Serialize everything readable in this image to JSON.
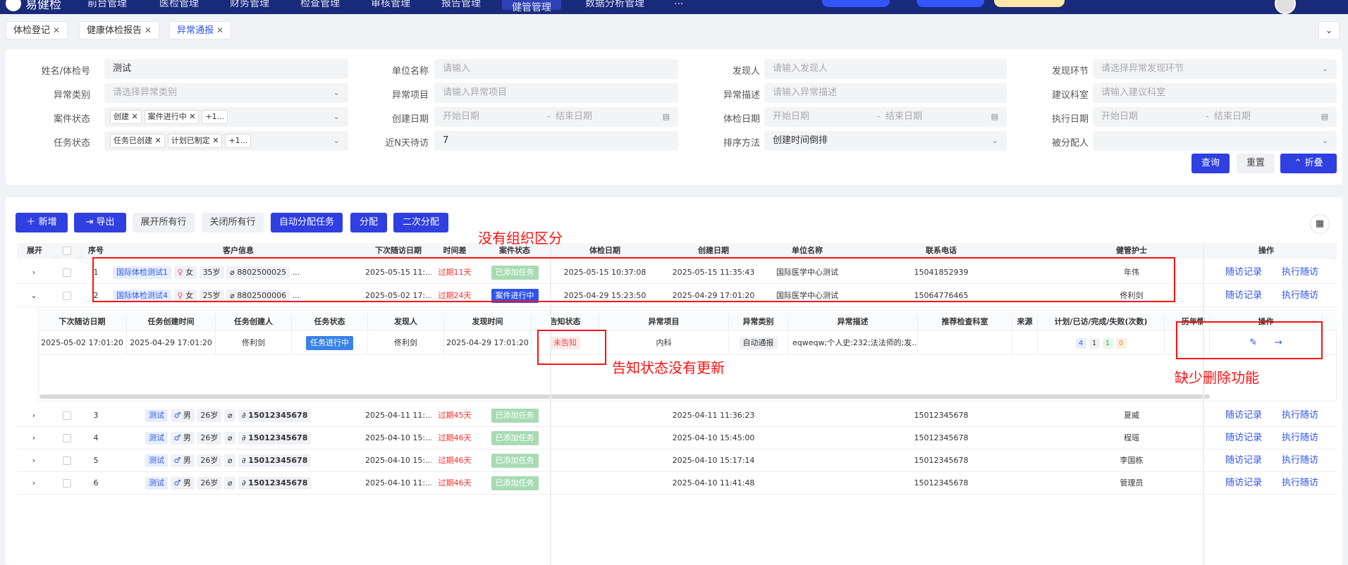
{
  "topbar": {
    "brand": "易健检",
    "nav": [
      "前台管理",
      "医检管理",
      "财务管理",
      "检查管理",
      "审核管理",
      "报告管理",
      "健管管理",
      "数据分析管理",
      "..."
    ]
  },
  "tabs": [
    {
      "label": "体检登记"
    },
    {
      "label": "健康体检报告"
    },
    {
      "label": "异常通报"
    }
  ],
  "tabs_more_icon": "chevron-down-icon",
  "filters": {
    "name_label": "姓名/体检号",
    "name_value": "测试",
    "company_label": "单位名称",
    "company_ph": "请输入",
    "finder_label": "发现人",
    "finder_ph": "请输入发现人",
    "stage_label": "发现环节",
    "stage_ph": "请选择异常发现环节",
    "abn_type_label": "异常类别",
    "abn_type_ph": "请选择异常类别",
    "abn_item_label": "异常项目",
    "abn_item_ph": "请输入异常项目",
    "abn_desc_label": "异常描述",
    "abn_desc_ph": "请输入异常描述",
    "dept_label": "建议科室",
    "dept_ph": "请输入建议科室",
    "case_status_label": "案件状态",
    "case_chips": [
      "创建",
      "案件进行中",
      "+1..."
    ],
    "create_date_label": "创建日期",
    "exam_date_label": "体检日期",
    "exec_date_label": "执行日期",
    "start_ph": "开始日期",
    "end_ph": "结束日期",
    "sep": "-",
    "task_status_label": "任务状态",
    "task_chips": [
      "任务已创建",
      "计划已制定",
      "+1..."
    ],
    "recent_label": "近N天待访",
    "recent_value": "7",
    "sort_label": "排序方法",
    "sort_value": "创建时间倒排",
    "assignee_label": "被分配人",
    "query": "查询",
    "reset": "重置",
    "collapse": "折叠"
  },
  "toolbar": {
    "add": "新增",
    "export": "导出",
    "expand_all": "展开所有行",
    "collapse_all": "关闭所有行",
    "auto_assign": "自动分配任务",
    "assign": "分配",
    "reassign": "二次分配"
  },
  "table": {
    "headers": [
      "展开",
      "序号",
      "客户信息",
      "下次随访日期",
      "时间差",
      "案件状态",
      "体检日期",
      "创建日期",
      "单位名称",
      "联系电话",
      "健管护士",
      "操作"
    ],
    "rows": [
      {
        "no": "1",
        "name": "国际体检测试1",
        "gender": "女",
        "age": "35岁",
        "id": "8802500025",
        "more": "...",
        "next": "2025-05-15 11:...",
        "diff": "过期11天",
        "status": "已添加任务",
        "exam": "2025-05-15 10:37:08",
        "created": "2025-05-15 11:35:43",
        "company": "国际医学中心测试",
        "phone": "15041852939",
        "nurse": "年伟",
        "a1": "随访记录",
        "a2": "执行随访"
      },
      {
        "no": "2",
        "name": "国际体检测试4",
        "gender": "女",
        "age": "25岁",
        "id": "8802500006",
        "more": "...",
        "next": "2025-05-02 17:...",
        "diff": "过期24天",
        "status": "案件进行中",
        "exam": "2025-04-29 15:23:50",
        "created": "2025-04-29 17:01:20",
        "company": "国际医学中心测试",
        "phone": "15064776465",
        "nurse": "佟利剑",
        "a1": "随访记录",
        "a2": "执行随访"
      },
      {
        "no": "3",
        "name": "测试",
        "gender": "男",
        "age": "26岁",
        "id": "15012345678",
        "next": "2025-04-11 11:...",
        "diff": "过期45天",
        "status": "已添加任务",
        "exam": "",
        "created": "2025-04-11 11:36:23",
        "company": "",
        "phone": "15012345678",
        "nurse": "夏威",
        "a1": "随访记录",
        "a2": "执行随访"
      },
      {
        "no": "4",
        "name": "测试",
        "gender": "男",
        "age": "26岁",
        "id": "15012345678",
        "next": "2025-04-10 15:...",
        "diff": "过期46天",
        "status": "已添加任务",
        "exam": "",
        "created": "2025-04-10 15:45:00",
        "company": "",
        "phone": "15012345678",
        "nurse": "程瑶",
        "a1": "随访记录",
        "a2": "执行随访"
      },
      {
        "no": "5",
        "name": "测试",
        "gender": "男",
        "age": "26岁",
        "id": "15012345678",
        "next": "2025-04-10 15:...",
        "diff": "过期46天",
        "status": "已添加任务",
        "exam": "",
        "created": "2025-04-10 15:17:14",
        "company": "",
        "phone": "15012345678",
        "nurse": "李国栋",
        "a1": "随访记录",
        "a2": "执行随访"
      },
      {
        "no": "6",
        "name": "测试",
        "gender": "男",
        "age": "26岁",
        "id": "15012345678",
        "next": "2025-04-10 11:...",
        "diff": "过期46天",
        "status": "已添加任务",
        "exam": "",
        "created": "2025-04-10 11:41:48",
        "company": "",
        "phone": "15012345678",
        "nurse": "管理员",
        "a1": "随访记录",
        "a2": "执行随访"
      }
    ]
  },
  "subtable": {
    "headers": [
      "下次随访日期",
      "任务创建时间",
      "任务创建人",
      "任务状态",
      "发现人",
      "发现时间",
      "告知状态",
      "异常项目",
      "异常类别",
      "异常描述",
      "推荐检查科室",
      "来源",
      "计划/已访/完成/失败(次数)",
      "历年情",
      "操作"
    ],
    "row": {
      "next": "2025-05-02 17:01:20",
      "created": "2025-04-29 17:01:20",
      "creator": "佟利剑",
      "status": "任务进行中",
      "finder": "佟利剑",
      "found": "2025-04-29 17:01:20",
      "notify": "未告知",
      "item": "内科",
      "type": "自动通报",
      "desc": "eqweqw;个人史:232;法法师的;发...",
      "counts": [
        "4",
        "1",
        "1",
        "0"
      ]
    }
  },
  "annotations": {
    "no_org": "没有组织区分",
    "notify_not_updated": "告知状态没有更新",
    "missing_delete": "缺少删除功能"
  },
  "colors": {
    "primary": "#2f3fe0",
    "annotation": "#ff1111",
    "overdue": "#ff2a2a"
  }
}
